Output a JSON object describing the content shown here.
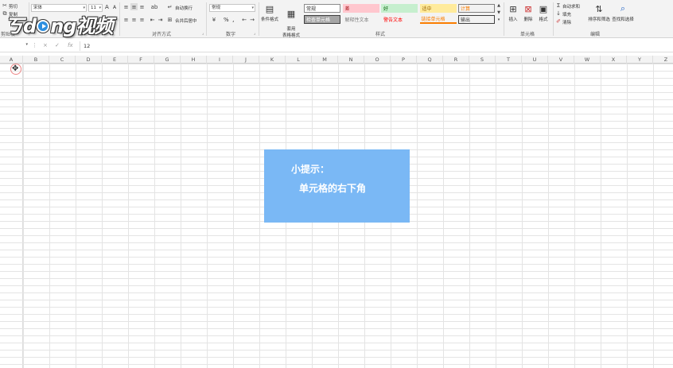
{
  "ribbon": {
    "clipboard": {
      "cut": "剪切",
      "copy": "复制",
      "label": "剪贴板"
    },
    "font": {
      "name": "宋体",
      "size": "11",
      "grow": "A",
      "shrink": "A"
    },
    "alignment": {
      "wrap_text": "自动换行",
      "merge_center": "合并后居中",
      "label": "对齐方式"
    },
    "number": {
      "format": "常规",
      "percent": "%",
      "comma": ",",
      "label": "数字"
    },
    "styles": {
      "conditional_format": "条件格式",
      "format_as_table": "套用\n表格格式",
      "cells": [
        {
          "text": "常规",
          "bg": "#ffffff",
          "fg": "#333333",
          "border": "#8a8a8a"
        },
        {
          "text": "差",
          "bg": "#ffc7ce",
          "fg": "#9c0006",
          "border": "#ffc7ce"
        },
        {
          "text": "好",
          "bg": "#c6efce",
          "fg": "#006100",
          "border": "#c6efce"
        },
        {
          "text": "适中",
          "bg": "#ffeb9c",
          "fg": "#9c6500",
          "border": "#ffeb9c"
        },
        {
          "text": "计算",
          "bg": "#f2f2f2",
          "fg": "#fa7d00",
          "border": "#7f7f7f"
        },
        {
          "text": "检查单元格",
          "bg": "#a5a5a5",
          "fg": "#ffffff",
          "border": "#3f3f3f"
        },
        {
          "text": "解释性文本",
          "bg": "#f3f3f3",
          "fg": "#7f7f7f",
          "border": "#f3f3f3"
        },
        {
          "text": "警告文本",
          "bg": "#f3f3f3",
          "fg": "#ff0000",
          "border": "#f3f3f3"
        },
        {
          "text": "链接单元格",
          "bg": "#f3f3f3",
          "fg": "#fa7d00",
          "border": "#fa7d00"
        },
        {
          "text": "输出",
          "bg": "#f2f2f2",
          "fg": "#3f3f3f",
          "border": "#3f3f3f"
        }
      ],
      "label": "样式"
    },
    "cells_group": {
      "insert": "插入",
      "delete": "删除",
      "format": "格式",
      "label": "单元格"
    },
    "editing": {
      "autosum": "自动求和",
      "fill": "填充",
      "clear": "清除",
      "sort_filter": "排序和筛选",
      "find_select": "查找和选择",
      "label": "编辑"
    }
  },
  "logo": {
    "text_a": "ㄎ",
    "text_b": "d",
    "text_c": "ng",
    "text_d": "视频"
  },
  "formula_bar": {
    "cancel": "×",
    "confirm": "✓",
    "fx": "fx",
    "value": "12"
  },
  "columns": [
    "A",
    "B",
    "C",
    "D",
    "E",
    "F",
    "G",
    "H",
    "I",
    "J",
    "K",
    "L",
    "M",
    "N",
    "O",
    "P",
    "Q",
    "R",
    "S",
    "T",
    "U",
    "V",
    "W",
    "X",
    "Y",
    "Z"
  ],
  "tip": {
    "title": "小提示：",
    "body": "单元格的右下角"
  }
}
